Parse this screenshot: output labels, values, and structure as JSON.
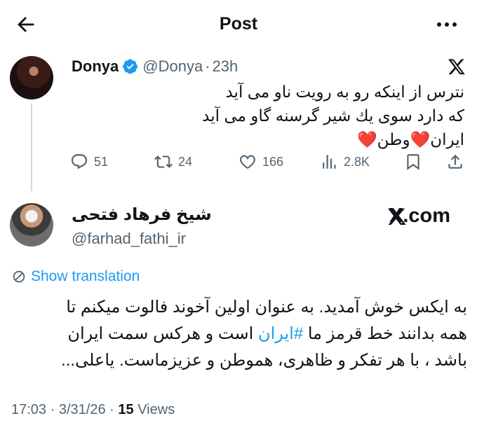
{
  "header": {
    "title": "Post"
  },
  "quoted": {
    "name": "Donya",
    "handle": "@Donya",
    "separator": "·",
    "time": "23h",
    "lines": [
      "نترس از اینکه رو به رویت ناو  می آید",
      "که دارد سوی یك شیر گرسنه گاو می آید",
      "ایران❤️وطن❤️"
    ],
    "stats": {
      "replies": "51",
      "reposts": "24",
      "likes": "166",
      "views": "2.8K"
    }
  },
  "post": {
    "name": "شیخ فرهاد فتحی",
    "handle": "@farhad_fathi_ir",
    "watermark": "X.com",
    "translate_label": "Show translation",
    "line1": "به ایکس خوش آمدید. به عنوان اولین آخوند فالوت میکنم تا",
    "line2_pre": "همه بدانند خط قرمز ما ",
    "hashtag": "#ایران",
    "line2_post": " است و هرکس سمت ایران",
    "line3": "باشد ، با هر تفکر و ظاهری، هموطن و عزیزماست. یاعلی...",
    "time": "17:03",
    "date": "3/31/26",
    "dot": "·",
    "views_count": "15",
    "views_label": "Views"
  },
  "colors": {
    "accent": "#1d9bf0",
    "secondary_text": "#536471",
    "heart": "#e0245e"
  }
}
